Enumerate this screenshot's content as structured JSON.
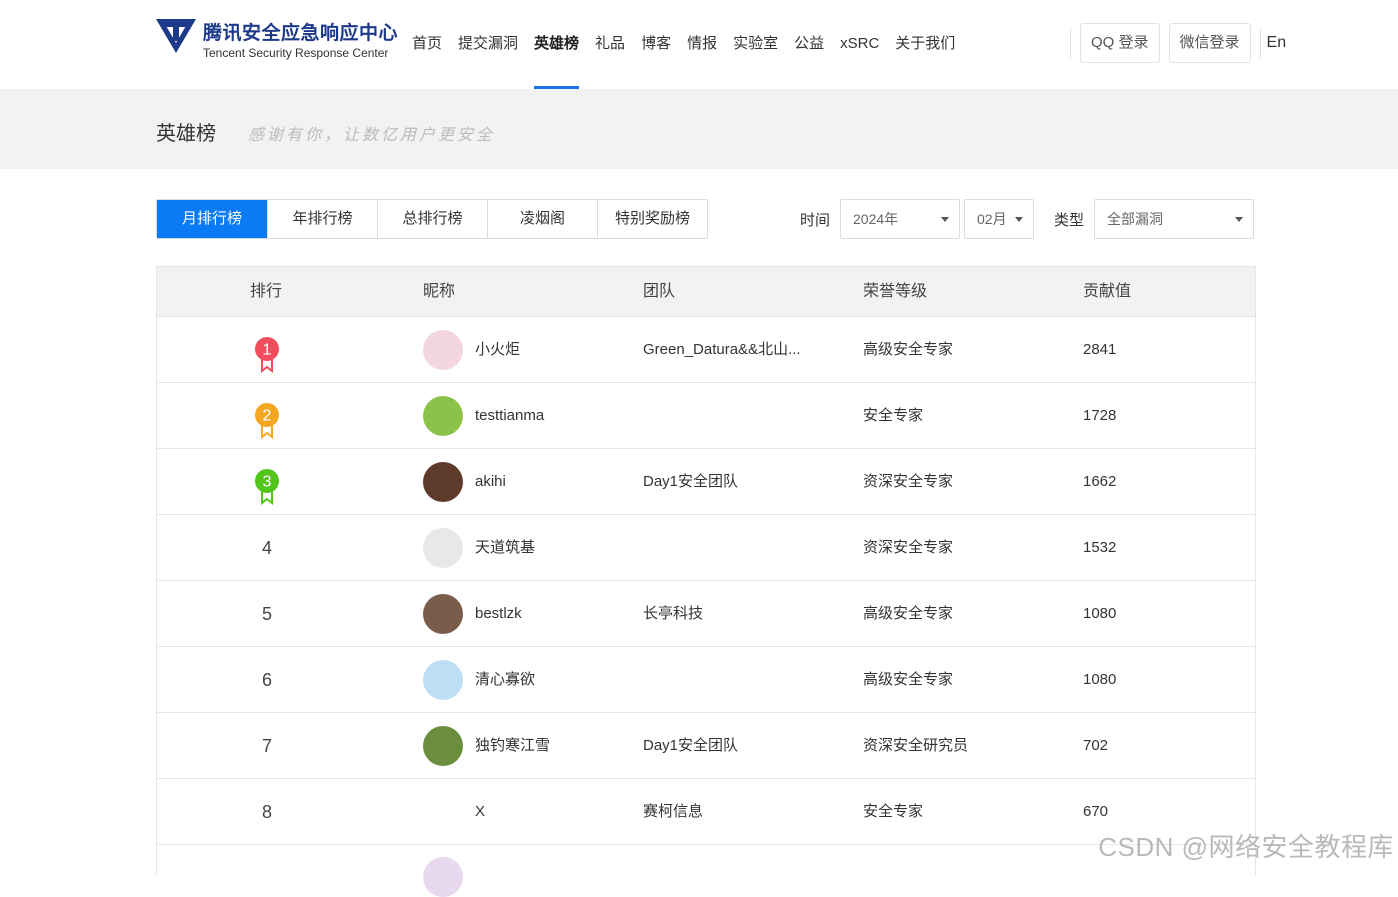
{
  "header": {
    "logo_cn": "腾讯安全应急响应中心",
    "logo_en": "Tencent Security Response Center",
    "nav": [
      "首页",
      "提交漏洞",
      "英雄榜",
      "礼品",
      "博客",
      "情报",
      "实验室",
      "公益",
      "xSRC",
      "关于我们"
    ],
    "nav_active": "英雄榜",
    "qq_login": "QQ 登录",
    "wechat_login": "微信登录",
    "lang": "En"
  },
  "banner": {
    "title": "英雄榜",
    "subtitle": "感谢有你，让数亿用户更安全"
  },
  "tabs": {
    "items": [
      "月排行榜",
      "年排行榜",
      "总排行榜",
      "凌烟阁",
      "特别奖励榜"
    ],
    "active": "月排行榜"
  },
  "filters": {
    "time_label": "时间",
    "year": "2024年",
    "month": "02月",
    "type_label": "类型",
    "type": "全部漏洞"
  },
  "table": {
    "columns": [
      "排行",
      "昵称",
      "团队",
      "荣誉等级",
      "贡献值"
    ],
    "rows": [
      {
        "rank": "1",
        "name": "小火炬",
        "team": "Green_Datura&&北山...",
        "level": "高级安全专家",
        "score": "2841",
        "medal": "#f24d5d"
      },
      {
        "rank": "2",
        "name": "testtianma",
        "team": "",
        "level": "安全专家",
        "score": "1728",
        "medal": "#f5a623"
      },
      {
        "rank": "3",
        "name": "akihi",
        "team": "Day1安全团队",
        "level": "资深安全专家",
        "score": "1662",
        "medal": "#52c41a"
      },
      {
        "rank": "4",
        "name": "天道筑基",
        "team": "",
        "level": "资深安全专家",
        "score": "1532"
      },
      {
        "rank": "5",
        "name": "bestlzk",
        "team": "长亭科技",
        "level": "高级安全专家",
        "score": "1080"
      },
      {
        "rank": "6",
        "name": "清心寡欲",
        "team": "",
        "level": "高级安全专家",
        "score": "1080"
      },
      {
        "rank": "7",
        "name": "独钓寒江雪",
        "team": "Day1安全团队",
        "level": "资深安全研究员",
        "score": "702"
      },
      {
        "rank": "8",
        "name": "X",
        "team": "赛柯信息",
        "level": "安全专家",
        "score": "670"
      }
    ]
  },
  "watermark": "CSDN @网络安全教程库"
}
